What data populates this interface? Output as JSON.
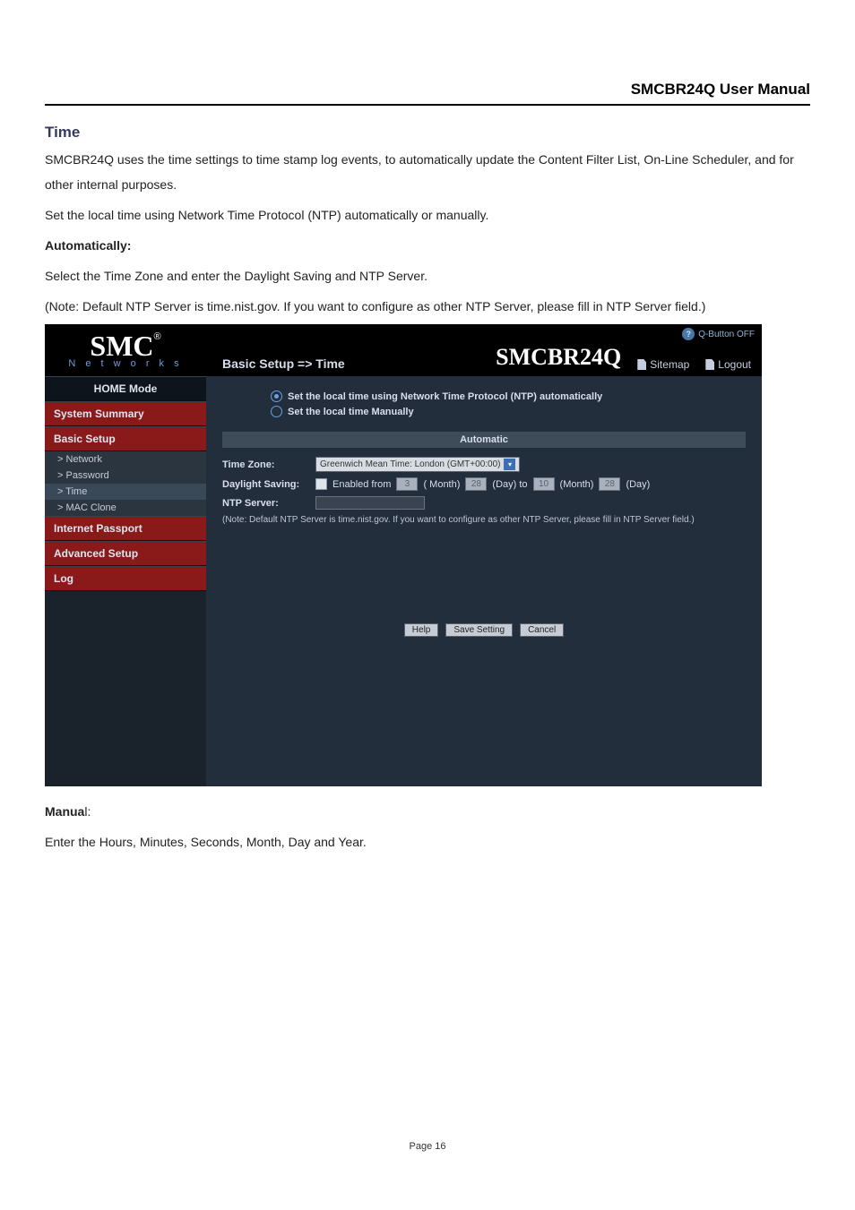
{
  "doc_header": "SMCBR24Q User Manual",
  "section_title": "Time",
  "body": {
    "p1": "SMCBR24Q uses the time settings to time stamp log events, to automatically update the Content Filter List, On-Line Scheduler, and for other internal purposes.",
    "p2": "Set the local time using Network Time Protocol (NTP) automatically or manually.",
    "auto_head": "Automatically:",
    "p3": "Select the Time Zone and enter the Daylight Saving and NTP Server.",
    "p4": "(Note: Default NTP Server is time.nist.gov. If you want to configure as other NTP Server, please fill in NTP Server field.)",
    "manual_head_a": "Manua",
    "manual_head_b": "l:",
    "p5": "Enter the Hours, Minutes, Seconds, Month, Day and Year."
  },
  "ui": {
    "logo": {
      "big": "SMC",
      "reg": "®",
      "sub": "N e t w o r k s"
    },
    "qbutton": "Q-Button OFF",
    "breadcrumb": "Basic Setup => Time",
    "model": "SMCBR24Q",
    "links": {
      "sitemap": "Sitemap",
      "logout": "Logout"
    },
    "sidebar": {
      "home": "HOME Mode",
      "summary": "System Summary",
      "basic": "Basic Setup",
      "subs": {
        "network": "> Network",
        "password": "> Password",
        "time": "> Time",
        "mac": "> MAC Clone"
      },
      "passport": "Internet Passport",
      "advanced": "Advanced Setup",
      "log": "Log"
    },
    "form": {
      "radio_auto": "Set the local time using Network Time Protocol (NTP) automatically",
      "radio_manual": "Set the local time Manually",
      "section": "Automatic",
      "tz_label": "Time Zone:",
      "tz_value": "Greenwich Mean Time: London (GMT+00:00)",
      "ds_label": "Daylight Saving:",
      "ds_enabled": "Enabled from",
      "ds": {
        "from_month": "3",
        "m_lbl": "( Month)",
        "from_day": "28",
        "d_lbl": "(Day) to",
        "to_month": "10",
        "m_lbl2": "(Month)",
        "to_day": "28",
        "d_lbl2": "(Day)"
      },
      "ntp_label": "NTP Server:",
      "note": "(Note: Default NTP Server is time.nist.gov. If you want to configure as other NTP Server, please fill in NTP Server field.)",
      "buttons": {
        "help": "Help",
        "save": "Save Setting",
        "cancel": "Cancel"
      }
    }
  },
  "page_number": "Page 16"
}
